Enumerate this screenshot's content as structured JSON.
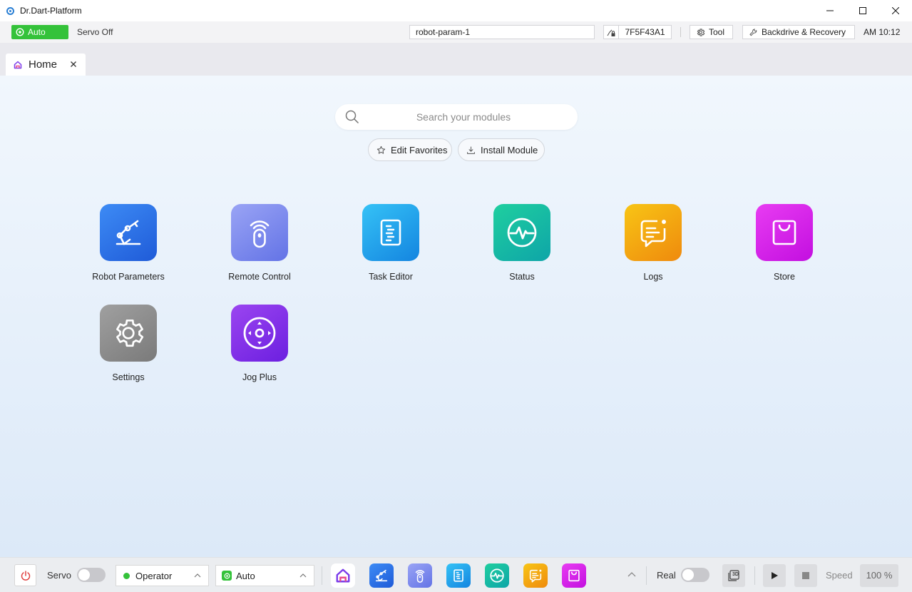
{
  "window": {
    "title": "Dr.Dart-Platform"
  },
  "status_bar": {
    "mode": "Auto",
    "servo_status": "Servo Off",
    "param_name": "robot-param-1",
    "robot_id": "7F5F43A1",
    "tool_label": "Tool",
    "backdrive_label": "Backdrive & Recovery",
    "time": "AM 10:12",
    "mode_color": "#34c23a"
  },
  "tabs": [
    {
      "label": "Home",
      "icon": "home-icon"
    }
  ],
  "main": {
    "search_placeholder": "Search your modules",
    "edit_favorites_label": "Edit Favorites",
    "install_module_label": "Install Module",
    "modules": [
      {
        "label": "Robot Parameters",
        "icon": "robot-arm-icon",
        "color": "#2f6fe6"
      },
      {
        "label": "Remote Control",
        "icon": "remote-control-icon",
        "color": "#7a86ee"
      },
      {
        "label": "Task Editor",
        "icon": "task-editor-icon",
        "color": "#1e9fe8"
      },
      {
        "label": "Status",
        "icon": "pulse-icon",
        "color": "#14b8a6"
      },
      {
        "label": "Logs",
        "icon": "message-icon",
        "color": "#f3a10f"
      },
      {
        "label": "Store",
        "icon": "shopping-bag-icon",
        "color": "#d61fe9"
      },
      {
        "label": "Settings",
        "icon": "gear-icon",
        "color": "#8d8d8d"
      },
      {
        "label": "Jog Plus",
        "icon": "joystick-icon",
        "color": "#8a2ee6"
      }
    ]
  },
  "bottom_bar": {
    "servo_label": "Servo",
    "operator_label": "Operator",
    "mode_label": "Auto",
    "real_label": "Real",
    "speed_label": "Speed",
    "speed_value": "100 %",
    "view_3d_label": "3D"
  }
}
